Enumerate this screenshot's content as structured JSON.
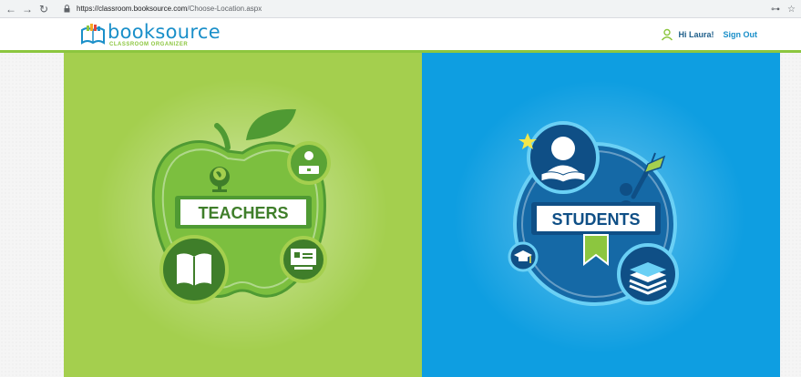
{
  "browser": {
    "url_host": "https://classroom.booksource.com",
    "url_path": "/Choose-Location.aspx"
  },
  "header": {
    "logo_text": "booksource",
    "logo_subtext": "CLASSROOM ORGANIZER",
    "greeting": "Hi Laura!",
    "sign_out": "Sign Out"
  },
  "panels": {
    "teachers_label": "TEACHERS",
    "students_label": "STUDENTS"
  },
  "colors": {
    "teachers_bg": "#a4cf4e",
    "students_bg": "#0e9ee1",
    "accent_green": "#8cc63f",
    "brand_blue": "#1a8fc9"
  }
}
